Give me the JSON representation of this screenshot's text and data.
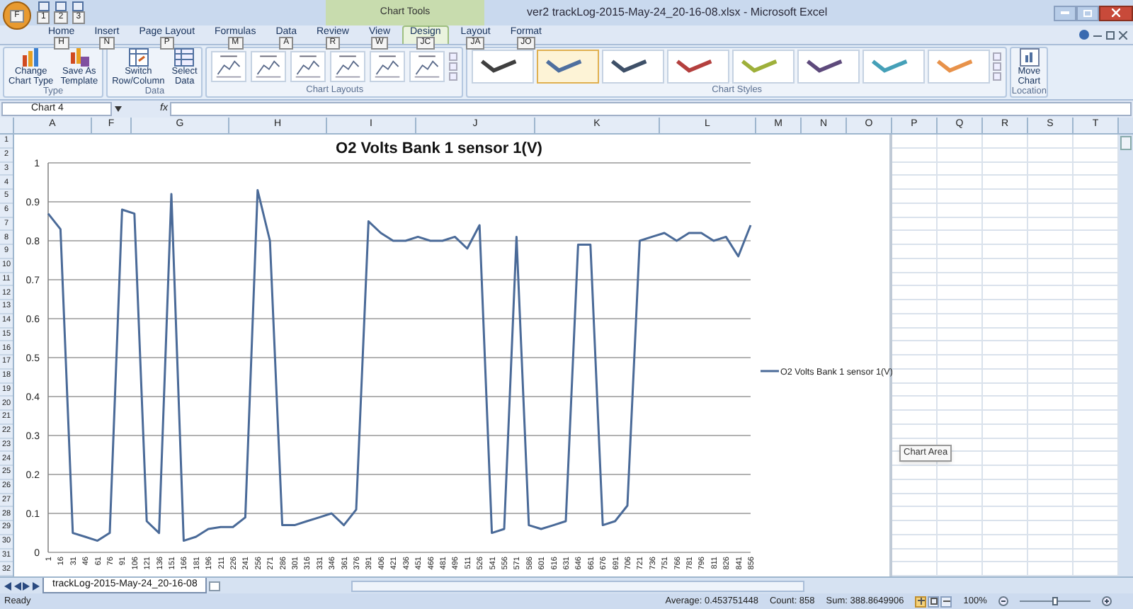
{
  "title_bar": {
    "office_keytip": "F",
    "quick_access_keytips": [
      "1",
      "2",
      "3"
    ],
    "context_label": "Chart Tools",
    "title": "ver2 trackLog-2015-May-24_20-16-08.xlsx - Microsoft Excel"
  },
  "tabs": [
    {
      "label": "Home",
      "keytip": "H",
      "selected": false
    },
    {
      "label": "Insert",
      "keytip": "N",
      "selected": false
    },
    {
      "label": "Page Layout",
      "keytip": "P",
      "selected": false
    },
    {
      "label": "Formulas",
      "keytip": "M",
      "selected": false
    },
    {
      "label": "Data",
      "keytip": "A",
      "selected": false
    },
    {
      "label": "Review",
      "keytip": "R",
      "selected": false
    },
    {
      "label": "View",
      "keytip": "W",
      "selected": false
    },
    {
      "label": "Design",
      "keytip": "JC",
      "selected": true
    },
    {
      "label": "Layout",
      "keytip": "JA",
      "selected": false
    },
    {
      "label": "Format",
      "keytip": "JO",
      "selected": false
    }
  ],
  "ribbon": {
    "groups": [
      {
        "label": "Type",
        "kind": "buttons",
        "buttons": [
          {
            "lines": [
              "Change",
              "Chart Type"
            ],
            "kind": "bars"
          },
          {
            "lines": [
              "Save As",
              "Template"
            ],
            "kind": "template"
          }
        ]
      },
      {
        "label": "Data",
        "kind": "buttons",
        "buttons": [
          {
            "lines": [
              "Switch",
              "Row/Column"
            ],
            "kind": "switch"
          },
          {
            "lines": [
              "Select",
              "Data"
            ],
            "kind": "select"
          }
        ]
      },
      {
        "label": "Chart Layouts",
        "kind": "layouts"
      },
      {
        "label": "Chart Styles",
        "kind": "styles",
        "styles": [
          {
            "color": "#3f3f3f",
            "selected": false
          },
          {
            "color": "#4f6f9f",
            "selected": true
          },
          {
            "color": "#3e5068",
            "selected": false
          },
          {
            "color": "#b4403e",
            "selected": false
          },
          {
            "color": "#9eb03a",
            "selected": false
          },
          {
            "color": "#5e4a7c",
            "selected": false
          },
          {
            "color": "#45a0b8",
            "selected": false
          },
          {
            "color": "#e8924a",
            "selected": false
          }
        ]
      },
      {
        "label": "Location",
        "kind": "buttons",
        "buttons": [
          {
            "lines": [
              "Move",
              "Chart"
            ],
            "kind": "move"
          }
        ]
      }
    ]
  },
  "formula_bar": {
    "name_box": "Chart 4",
    "fx": "fx"
  },
  "columns": [
    "A",
    "F",
    "G",
    "H",
    "I",
    "J",
    "K",
    "L",
    "M",
    "N",
    "O",
    "P",
    "Q",
    "R",
    "S",
    "T"
  ],
  "rows": [
    "1",
    "2",
    "3",
    "4",
    "5",
    "6",
    "7",
    "8",
    "9",
    "10",
    "11",
    "12",
    "13",
    "14",
    "15",
    "16",
    "17",
    "18",
    "19",
    "20",
    "21",
    "22",
    "23",
    "24",
    "25",
    "26",
    "27",
    "28",
    "29",
    "30",
    "31",
    "32"
  ],
  "chart": {
    "chart_data": {
      "type": "line",
      "title": "O2 Volts Bank 1 sensor 1(V)",
      "grid": true,
      "categories": [
        "1",
        "16",
        "31",
        "46",
        "61",
        "76",
        "91",
        "106",
        "121",
        "136",
        "151",
        "166",
        "181",
        "196",
        "211",
        "226",
        "241",
        "256",
        "271",
        "286",
        "301",
        "316",
        "331",
        "346",
        "361",
        "376",
        "391",
        "406",
        "421",
        "436",
        "451",
        "466",
        "481",
        "496",
        "511",
        "526",
        "541",
        "556",
        "571",
        "586",
        "601",
        "616",
        "631",
        "646",
        "661",
        "676",
        "691",
        "706",
        "721",
        "736",
        "751",
        "766",
        "781",
        "796",
        "811",
        "826",
        "841",
        "856"
      ],
      "series": [
        {
          "name": "O2 Volts Bank 1 sensor 1(V)",
          "color": "#4a6a98",
          "values": [
            0.87,
            0.83,
            0.05,
            0.04,
            0.03,
            0.05,
            0.88,
            0.87,
            0.08,
            0.05,
            0.92,
            0.03,
            0.04,
            0.06,
            0.065,
            0.065,
            0.09,
            0.93,
            0.8,
            0.07,
            0.07,
            0.08,
            0.09,
            0.1,
            0.07,
            0.11,
            0.85,
            0.82,
            0.8,
            0.8,
            0.81,
            0.8,
            0.8,
            0.81,
            0.78,
            0.84,
            0.05,
            0.06,
            0.81,
            0.07,
            0.06,
            0.07,
            0.08,
            0.79,
            0.79,
            0.07,
            0.08,
            0.12,
            0.8,
            0.81,
            0.82,
            0.8,
            0.82,
            0.82,
            0.8,
            0.81,
            0.76,
            0.84
          ]
        }
      ],
      "ylim": [
        0,
        1
      ],
      "yticks": [
        0,
        0.1,
        0.2,
        0.3,
        0.4,
        0.5,
        0.6,
        0.7,
        0.8,
        0.9,
        1
      ]
    }
  },
  "tooltip": "Chart Area",
  "sheet_tabs": [
    {
      "label": "trackLog-2015-May-24_20-16-08",
      "selected": true
    }
  ],
  "status_bar": {
    "mode": "Ready",
    "average": "Average: 0.453751448",
    "count": "Count: 858",
    "sum": "Sum: 388.8649906",
    "views": [
      {
        "kind": "normal",
        "selected": true
      },
      {
        "kind": "page_layout",
        "selected": false
      },
      {
        "kind": "page_break",
        "selected": false
      }
    ],
    "zoom": "100%",
    "zoom_slider": {
      "level": 0.5
    }
  }
}
